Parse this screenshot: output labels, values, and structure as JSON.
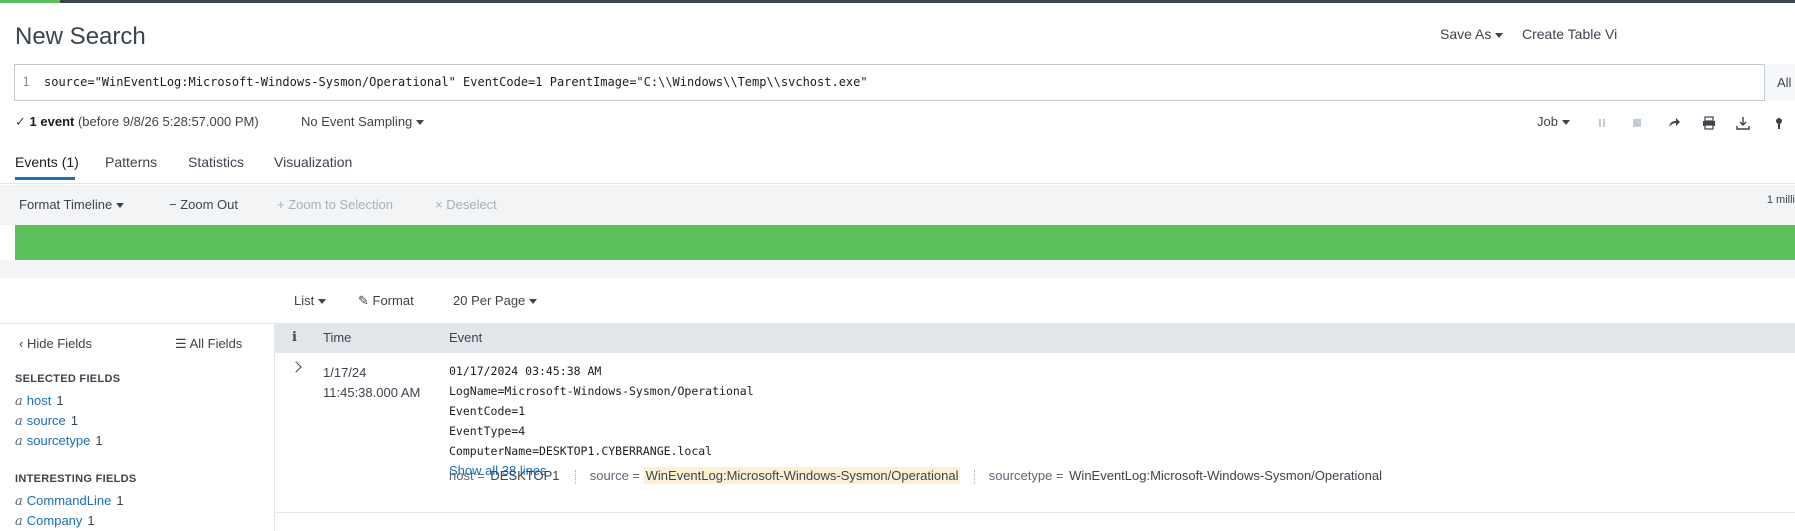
{
  "header": {
    "title": "New Search",
    "save_as": "Save As",
    "create_table": "Create Table Vi"
  },
  "search": {
    "line_number": "1",
    "query": "source=\"WinEventLog:Microsoft-Windows-Sysmon/Operational\" EventCode=1 ParentImage=\"C:\\\\Windows\\\\Temp\\\\svchost.exe\"",
    "time_range": "All"
  },
  "status": {
    "check": "✓",
    "count": "1 event",
    "detail": "(before 9/8/26 5:28:57.000 PM)",
    "sampling": "No Event Sampling"
  },
  "job": {
    "label": "Job"
  },
  "tabs": [
    {
      "label": "Events (1)"
    },
    {
      "label": "Patterns"
    },
    {
      "label": "Statistics"
    },
    {
      "label": "Visualization"
    }
  ],
  "timeline": {
    "format": "Format Timeline",
    "zoom_out": "Zoom Out",
    "zoom_selection": "Zoom to Selection",
    "deselect": "Deselect",
    "scale": "1 milli"
  },
  "results_toolbar": {
    "list": "List",
    "format": "Format",
    "per_page": "20 Per Page"
  },
  "sidebar": {
    "hide_fields": "Hide Fields",
    "all_fields": "All Fields",
    "selected_heading": "SELECTED FIELDS",
    "selected": [
      {
        "type": "a",
        "name": "host",
        "count": "1"
      },
      {
        "type": "a",
        "name": "source",
        "count": "1"
      },
      {
        "type": "a",
        "name": "sourcetype",
        "count": "1"
      }
    ],
    "interesting_heading": "INTERESTING FIELDS",
    "interesting": [
      {
        "type": "a",
        "name": "CommandLine",
        "count": "1"
      },
      {
        "type": "a",
        "name": "Company",
        "count": "1"
      }
    ]
  },
  "table": {
    "col_info": "i",
    "col_time": "Time",
    "col_event": "Event",
    "rows": [
      {
        "date": "1/17/24",
        "time": "11:45:38.000 AM",
        "lines": [
          "01/17/2024 03:45:38 AM",
          "LogName=Microsoft-Windows-Sysmon/Operational",
          "EventCode=1",
          "EventType=4",
          "ComputerName=DESKTOP1.CYBERRANGE.local"
        ],
        "show_all": "Show all 38 lines",
        "host_key": "host =",
        "host_val": "DESKTOP1",
        "source_key": "source =",
        "source_val": "WinEventLog:Microsoft-Windows-Sysmon/Operational",
        "sourcetype_key": "sourcetype =",
        "sourcetype_val": "WinEventLog:Microsoft-Windows-Sysmon/Operational"
      }
    ]
  },
  "colors": {
    "accent": "#1a6fb5",
    "timeline_bar": "#5cc05c",
    "highlight": "#fdf1d4"
  }
}
